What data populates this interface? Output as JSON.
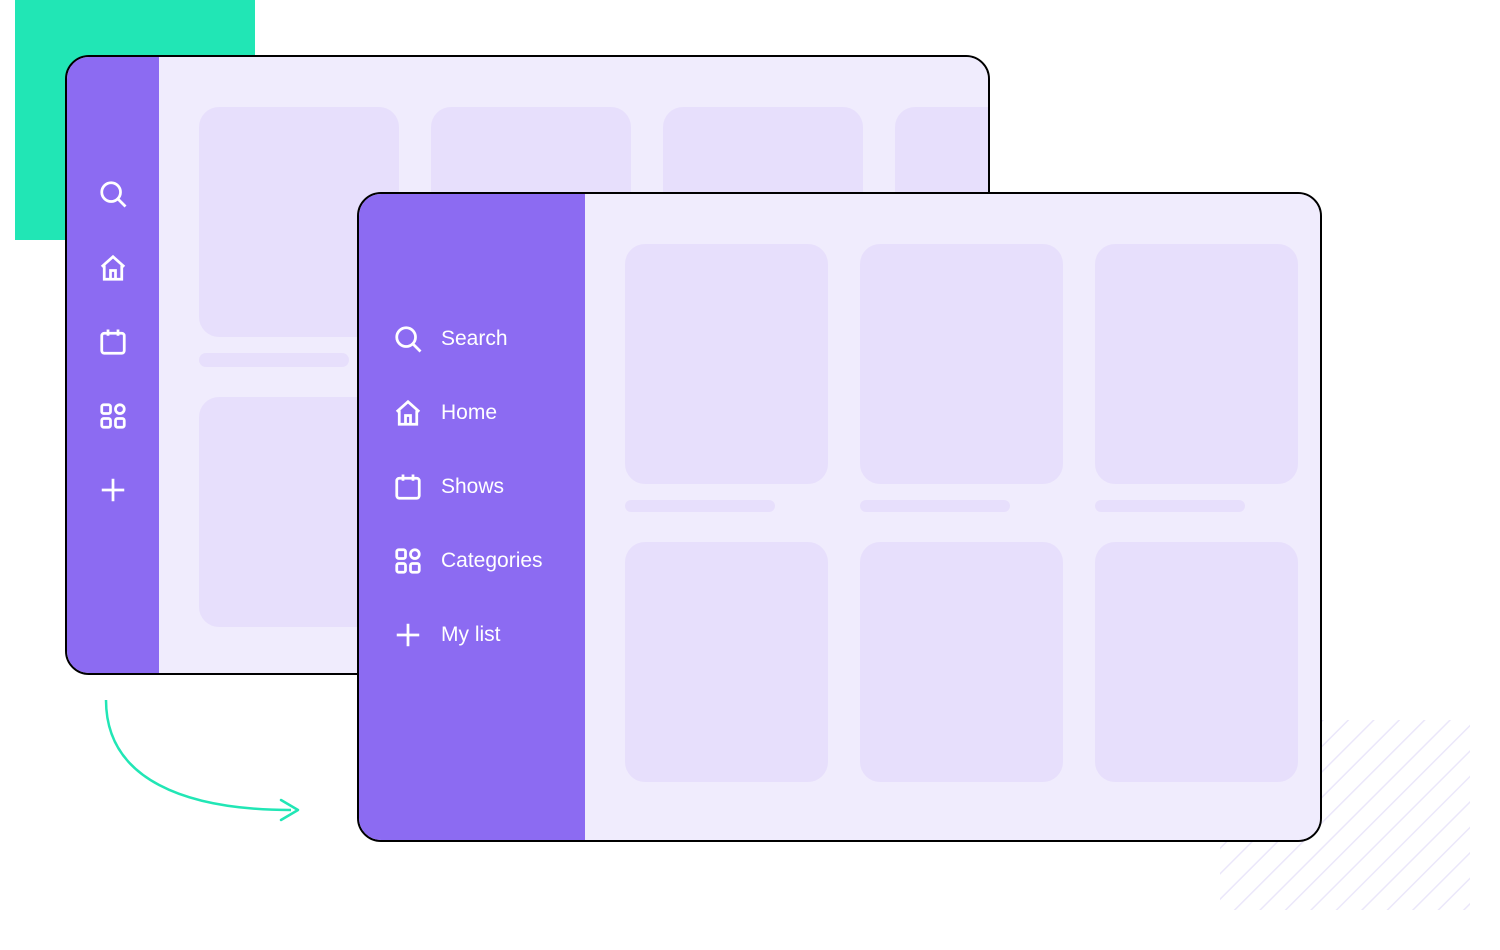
{
  "colors": {
    "accent": "#8C6BF2",
    "accent_light": "#F0ECFD",
    "teal": "#21E6B5",
    "placeholder": "#E7DFFC"
  },
  "nav": {
    "items": [
      {
        "icon": "search-icon",
        "label": "Search"
      },
      {
        "icon": "home-icon",
        "label": "Home"
      },
      {
        "icon": "calendar-icon",
        "label": "Shows"
      },
      {
        "icon": "grid-icon",
        "label": "Categories"
      },
      {
        "icon": "plus-icon",
        "label": "My list"
      }
    ]
  }
}
